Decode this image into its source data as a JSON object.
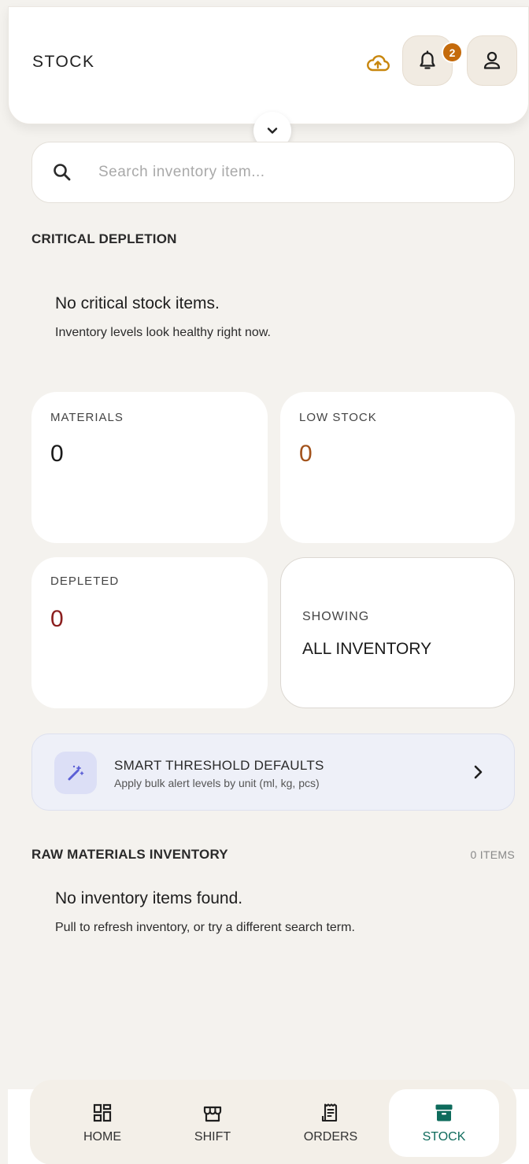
{
  "header": {
    "title": "STOCK",
    "notification_count": "2",
    "icons": [
      "cloud-upload-icon",
      "bell-icon",
      "user-icon",
      "chevron-down-icon"
    ]
  },
  "search": {
    "placeholder": "Search inventory item...",
    "value": ""
  },
  "critical": {
    "section_title": "CRITICAL DEPLETION",
    "empty_title": "No critical stock items.",
    "empty_subtitle": "Inventory levels look healthy right now."
  },
  "stats": {
    "materials": {
      "label": "MATERIALS",
      "value": "0"
    },
    "low_stock": {
      "label": "LOW STOCK",
      "value": "0"
    },
    "depleted": {
      "label": "DEPLETED",
      "value": "0"
    },
    "showing": {
      "label": "SHOWING",
      "value": "ALL INVENTORY"
    }
  },
  "threshold": {
    "title": "SMART THRESHOLD DEFAULTS",
    "subtitle": "Apply bulk alert levels by unit (ml, kg, pcs)"
  },
  "raw": {
    "section_title": "RAW MATERIALS INVENTORY",
    "count": "0 ITEMS",
    "empty_title": "No inventory items found.",
    "empty_subtitle": "Pull to refresh inventory, or try a different search term."
  },
  "nav": {
    "items": [
      {
        "label": "HOME",
        "icon": "dashboard-icon",
        "active": false
      },
      {
        "label": "SHIFT",
        "icon": "store-icon",
        "active": false
      },
      {
        "label": "ORDERS",
        "icon": "receipt-icon",
        "active": false
      },
      {
        "label": "STOCK",
        "icon": "archive-box-icon",
        "active": true
      }
    ]
  },
  "colors": {
    "accent": "#0e6b5c",
    "low_stock": "#a2521b",
    "depleted": "#8b1e1e",
    "badge": "#c46a0b",
    "cloud": "#c8860d",
    "wand": "#5b5fd6"
  }
}
